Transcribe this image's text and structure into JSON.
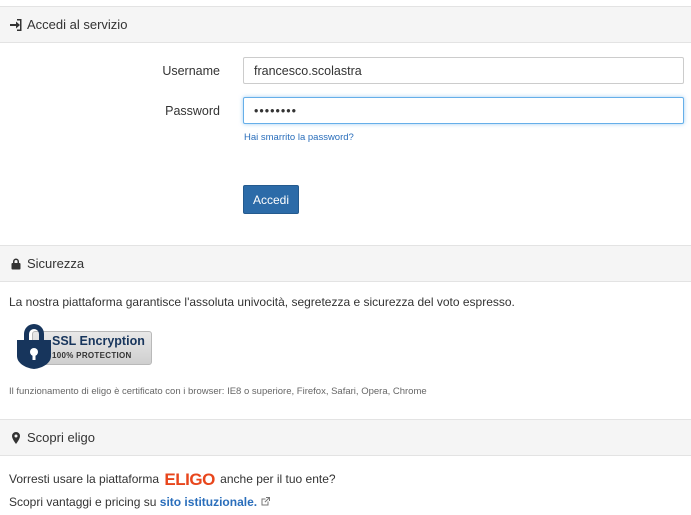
{
  "access": {
    "header": "Accedi al servizio",
    "username_label": "Username",
    "username_value": "francesco.scolastra",
    "password_label": "Password",
    "password_value": "••••••••",
    "forgot_link": "Hai smarrito la password?",
    "submit_label": "Accedi"
  },
  "security": {
    "header": "Sicurezza",
    "description": "La nostra piattaforma garantisce l'assoluta univocità, segretezza e sicurezza del voto espresso.",
    "badge_title": "SSL Encryption",
    "badge_subtitle": "100% PROTECTION",
    "browser_note": "Il funzionamento di eligo è certificato con i browser: IE8 o superiore, Firefox, Safari, Opera, Chrome"
  },
  "discover": {
    "header": "Scopri eligo",
    "line1_before": "Vorresti usare la piattaforma",
    "logo_text": "ELIGO",
    "line1_after": "anche per il tuo ente?",
    "line2_before": "Scopri vantaggi e pricing su",
    "line2_link": "sito istituzionale."
  },
  "colors": {
    "primary_button": "#2c6ba8",
    "link": "#2a6ebb",
    "logo": "#e8461c"
  },
  "icons": [
    "sign-in-icon",
    "lock-icon",
    "map-marker-icon",
    "external-link-icon",
    "padlock-shield-icon"
  ]
}
